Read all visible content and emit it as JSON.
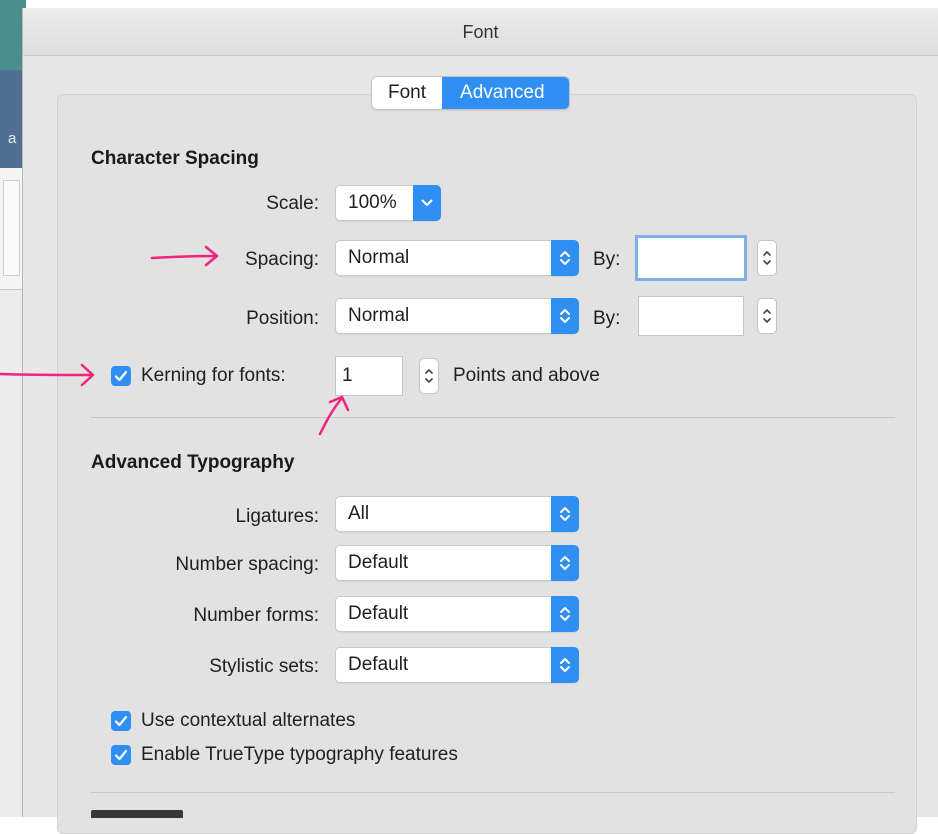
{
  "window": {
    "title": "Font"
  },
  "tabs": [
    {
      "label": "Font",
      "active": false
    },
    {
      "label": "Advanced",
      "active": true
    }
  ],
  "character_spacing": {
    "title": "Character Spacing",
    "scale": {
      "label": "Scale:",
      "value": "100%"
    },
    "spacing": {
      "label": "Spacing:",
      "value": "Normal",
      "by_label": "By:",
      "by_value": ""
    },
    "position": {
      "label": "Position:",
      "value": "Normal",
      "by_label": "By:",
      "by_value": ""
    },
    "kerning": {
      "checked": true,
      "label": "Kerning for fonts:",
      "value": "1",
      "suffix": "Points and above"
    }
  },
  "advanced_typography": {
    "title": "Advanced Typography",
    "ligatures": {
      "label": "Ligatures:",
      "value": "All"
    },
    "number_spacing": {
      "label": "Number spacing:",
      "value": "Default"
    },
    "number_forms": {
      "label": "Number forms:",
      "value": "Default"
    },
    "stylistic_sets": {
      "label": "Stylistic sets:",
      "value": "Default"
    },
    "contextual_alternates": {
      "checked": true,
      "label": "Use contextual alternates"
    },
    "truetype_features": {
      "checked": true,
      "label": "Enable TrueType typography features"
    }
  },
  "background": {
    "partial_char": "a"
  },
  "colors": {
    "accent": "#2f8ff2",
    "annotation": "#f0247a",
    "window_bg": "#e7e7e7"
  }
}
